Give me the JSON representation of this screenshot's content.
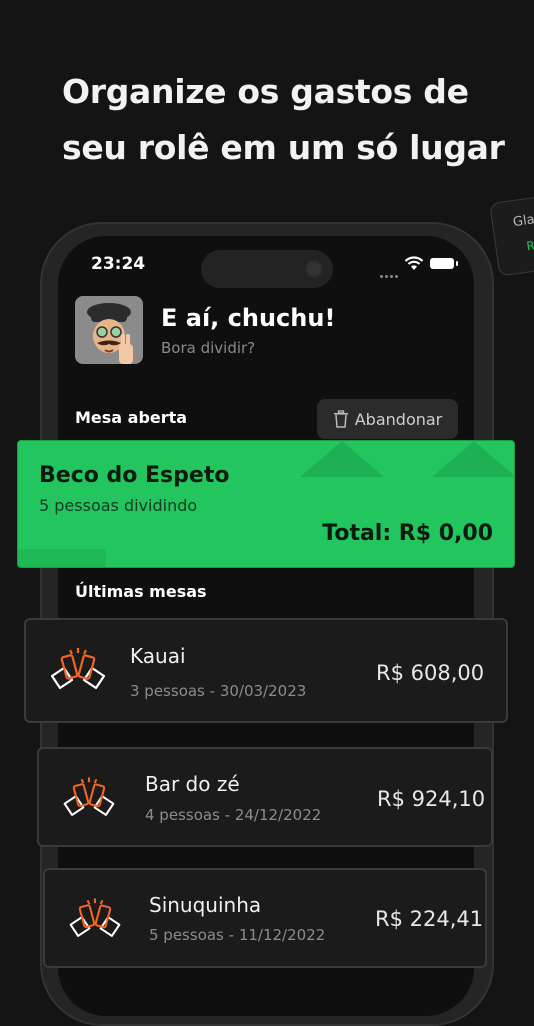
{
  "headline": {
    "line1": "Organize os gastos de",
    "line2": "seu rolê em um só lugar"
  },
  "peek_card": {
    "text1": "Gla",
    "text2": "R"
  },
  "status_bar": {
    "time": "23:24"
  },
  "user": {
    "greeting": "E aí, chuchu!",
    "subtitle": "Bora dividir?"
  },
  "open_table": {
    "section_label": "Mesa aberta",
    "abandon_label": "Abandonar",
    "name": "Beco do Espeto",
    "people": "5 pessoas dividindo",
    "total": "Total: R$ 0,00"
  },
  "history": {
    "section_label": "Últimas mesas",
    "items": [
      {
        "name": "Kauai",
        "meta": "3 pessoas - 30/03/2023",
        "amount": "R$ 608,00",
        "icon": "toast-icon"
      },
      {
        "name": "Bar do zé",
        "meta": "4 pessoas - 24/12/2022",
        "amount": "R$ 924,10",
        "icon": "toast-icon"
      },
      {
        "name": "Sinuquinha",
        "meta": "5 pessoas - 11/12/2022",
        "amount": "R$ 224,41",
        "icon": "toast-icon"
      }
    ]
  },
  "colors": {
    "background": "#141414",
    "accent": "#22c55e",
    "icon_orange": "#f26522"
  }
}
